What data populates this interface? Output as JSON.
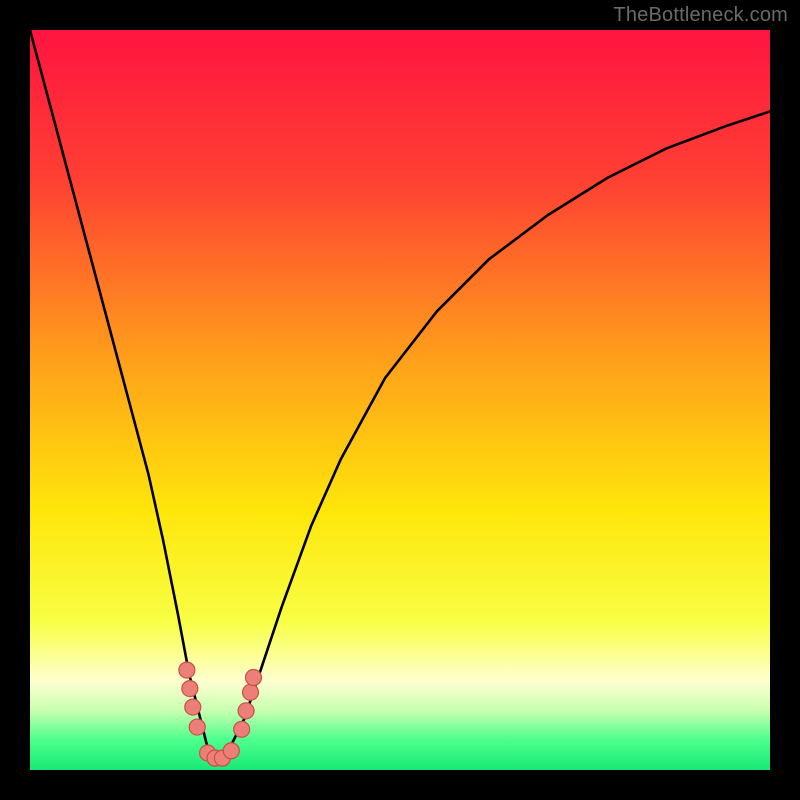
{
  "watermark": "TheBottleneck.com",
  "chart_data": {
    "type": "line",
    "title": "",
    "xlabel": "",
    "ylabel": "",
    "xlim": [
      0,
      100
    ],
    "ylim": [
      0,
      100
    ],
    "x": [
      0,
      4,
      8,
      12,
      16,
      18,
      20,
      21.5,
      23,
      24,
      25,
      26,
      27,
      29,
      31,
      34,
      38,
      42,
      48,
      55,
      62,
      70,
      78,
      86,
      94,
      100
    ],
    "y": [
      100,
      85,
      70,
      55,
      40,
      31,
      21,
      13,
      7,
      3,
      1.5,
      1.5,
      3,
      7,
      13,
      22,
      33,
      42,
      53,
      62,
      69,
      75,
      80,
      84,
      87,
      89
    ],
    "gradient_stops": [
      {
        "offset": 0.0,
        "color": "#ff1440"
      },
      {
        "offset": 0.2,
        "color": "#ff3f33"
      },
      {
        "offset": 0.45,
        "color": "#ffa11a"
      },
      {
        "offset": 0.65,
        "color": "#ffe60a"
      },
      {
        "offset": 0.8,
        "color": "#f8ff45"
      },
      {
        "offset": 0.88,
        "color": "#ffffd0"
      },
      {
        "offset": 0.92,
        "color": "#c7ffb0"
      },
      {
        "offset": 0.96,
        "color": "#4bff8c"
      },
      {
        "offset": 1.0,
        "color": "#19e876"
      }
    ],
    "markers": [
      {
        "x": 21.2,
        "y": 13.5
      },
      {
        "x": 21.6,
        "y": 11.0
      },
      {
        "x": 22.0,
        "y": 8.5
      },
      {
        "x": 22.6,
        "y": 5.8
      },
      {
        "x": 24.0,
        "y": 2.3
      },
      {
        "x": 25.0,
        "y": 1.6
      },
      {
        "x": 26.0,
        "y": 1.6
      },
      {
        "x": 27.2,
        "y": 2.6
      },
      {
        "x": 28.6,
        "y": 5.5
      },
      {
        "x": 29.2,
        "y": 8.0
      },
      {
        "x": 29.8,
        "y": 10.5
      },
      {
        "x": 30.2,
        "y": 12.5
      }
    ],
    "marker_color": "#ec7f78",
    "marker_stroke": "#c94f47",
    "line_color": "#000000"
  }
}
